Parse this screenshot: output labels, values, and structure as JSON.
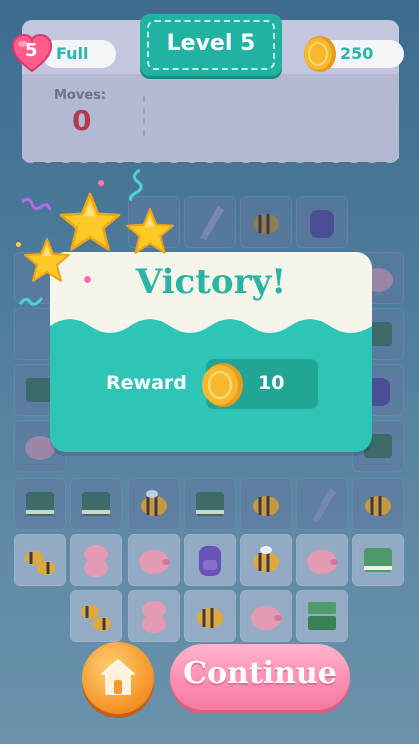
{
  "hud": {
    "lives": {
      "count": "5",
      "status": "Full"
    },
    "level_label": "Level 5",
    "coins": "250",
    "moves": {
      "label": "Moves:",
      "value": "0"
    }
  },
  "popup": {
    "title": "Victory!",
    "stars_earned": 3,
    "reward_label": "Reward",
    "reward_amount": "10"
  },
  "buttons": {
    "continue_label": "Continue",
    "home_icon": "home-icon"
  },
  "board_items": [
    "book",
    "bee",
    "piggy-bank",
    "backpack",
    "umbrella"
  ],
  "colors": {
    "teal": "#2ec4b6",
    "coin_gold": "#f5b82e",
    "heart_pink": "#ff5c8a",
    "continue_pink": "#ff8fb2",
    "home_orange": "#f79a2e"
  }
}
